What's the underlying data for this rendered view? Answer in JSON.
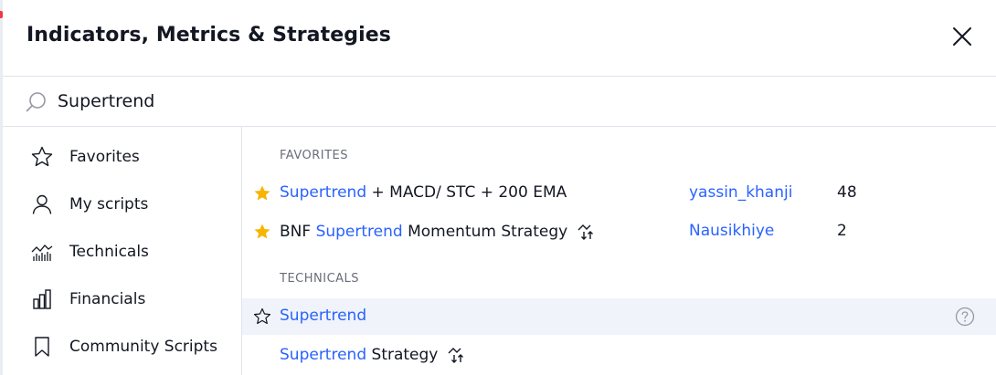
{
  "dialog": {
    "title": "Indicators, Metrics & Strategies",
    "close_icon": "close-icon"
  },
  "search": {
    "value": "Supertrend",
    "icon": "search-icon"
  },
  "sidebar": {
    "items": [
      {
        "label": "Favorites",
        "icon": "star-outline-icon"
      },
      {
        "label": "My scripts",
        "icon": "user-icon"
      },
      {
        "label": "Technicals",
        "icon": "technicals-chart-icon"
      },
      {
        "label": "Financials",
        "icon": "bar-chart-icon"
      },
      {
        "label": "Community Scripts",
        "icon": "bookmark-icon"
      }
    ]
  },
  "results": {
    "favorites_title": "FAVORITES",
    "technicals_title": "TECHNICALS",
    "favorites": [
      {
        "prefix": "",
        "highlight": "Supertrend",
        "suffix": " + MACD/ STC + 200 EMA",
        "author": "yassin_khanji",
        "count": "48",
        "starred": true,
        "strategy": false
      },
      {
        "prefix": "BNF ",
        "highlight": "Supertrend",
        "suffix": " Momentum Strategy",
        "author": "Nausikhiye",
        "count": "2",
        "starred": true,
        "strategy": true
      }
    ],
    "technicals": [
      {
        "prefix": "",
        "highlight": "Supertrend",
        "suffix": "",
        "starred": false,
        "strategy": false,
        "help": true
      },
      {
        "prefix": "",
        "highlight": "Supertrend",
        "suffix": " Strategy",
        "starred": false,
        "strategy": true,
        "help": false
      }
    ]
  },
  "colors": {
    "accent": "#2962ff",
    "star": "#f7b500",
    "hover_row": "#f0f3fa",
    "divider": "#e0e3eb"
  }
}
